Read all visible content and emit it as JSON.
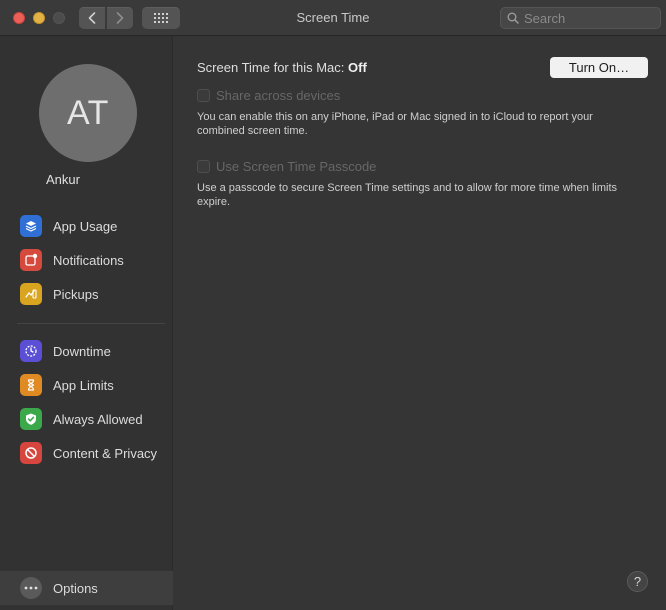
{
  "window": {
    "title": "Screen Time",
    "search_placeholder": "Search"
  },
  "sidebar": {
    "avatar_initials": "AT",
    "username": "Ankur",
    "items": [
      {
        "label": "App Usage",
        "icon": "app-usage-icon",
        "color": "#2f6fd6"
      },
      {
        "label": "Notifications",
        "icon": "notifications-icon",
        "color": "#d64a3e"
      },
      {
        "label": "Pickups",
        "icon": "pickups-icon",
        "color": "#d9a41f"
      },
      {
        "label": "Downtime",
        "icon": "downtime-icon",
        "color": "#5b4fd6"
      },
      {
        "label": "App Limits",
        "icon": "app-limits-icon",
        "color": "#e08a24"
      },
      {
        "label": "Always Allowed",
        "icon": "always-allowed-icon",
        "color": "#3ba84a"
      },
      {
        "label": "Content & Privacy",
        "icon": "content-privacy-icon",
        "color": "#d6453e"
      }
    ],
    "options_label": "Options"
  },
  "main": {
    "status_label": "Screen Time for this Mac:",
    "status_value": "Off",
    "turn_on_label": "Turn On…",
    "share": {
      "label": "Share across devices",
      "checked": false,
      "description": "You can enable this on any iPhone, iPad or Mac signed in to iCloud to report your combined screen time."
    },
    "passcode": {
      "label": "Use Screen Time Passcode",
      "checked": false,
      "description": "Use a passcode to secure Screen Time settings and to allow for more time when limits expire."
    },
    "help_label": "?"
  }
}
